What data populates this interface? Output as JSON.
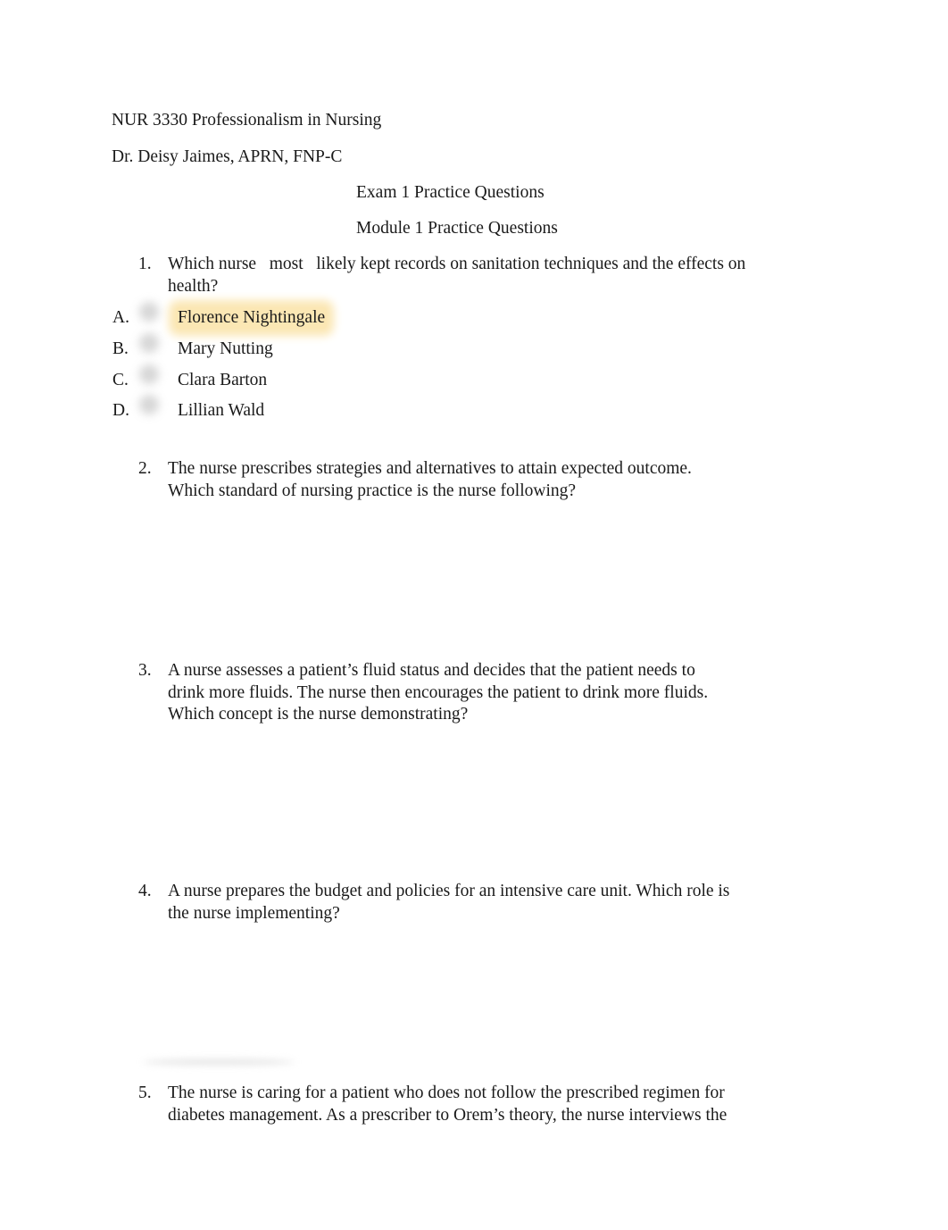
{
  "header": {
    "course": "NUR 3330 Professionalism in Nursing",
    "instructor": "Dr. Deisy Jaimes, APRN, FNP-C",
    "title": "Exam 1 Practice Questions",
    "subtitle": "Module 1 Practice Questions"
  },
  "questions": [
    {
      "number": "1.",
      "lines": [
        "Which nurse   most   likely kept records on sanitation techniques and the effects on",
        "health?"
      ],
      "options": [
        {
          "letter": "A.",
          "label": "Florence Nightingale",
          "highlighted": true
        },
        {
          "letter": "B.",
          "label": "Mary Nutting",
          "highlighted": false
        },
        {
          "letter": "C.",
          "label": "Clara Barton",
          "highlighted": false
        },
        {
          "letter": "D.",
          "label": "Lillian Wald",
          "highlighted": false
        }
      ]
    },
    {
      "number": "2.",
      "lines": [
        "The nurse prescribes strategies and alternatives to attain expected outcome.",
        "Which standard of nursing practice is the nurse following?"
      ]
    },
    {
      "number": "3.",
      "lines": [
        "A nurse assesses a patient’s fluid status and decides that the patient needs to",
        "drink more fluids. The nurse then encourages the patient to drink more fluids.",
        "Which concept is the nurse demonstrating?"
      ]
    },
    {
      "number": "4.",
      "lines": [
        "A nurse prepares the budget and policies for an intensive care unit. Which role is",
        "the nurse implementing?"
      ]
    },
    {
      "number": "5.",
      "lines": [
        "The nurse is caring for a patient who does not follow the prescribed regimen for",
        "diabetes management. As a prescriber to Orem’s theory, the nurse interviews the"
      ]
    }
  ],
  "colors": {
    "text": "#1a1a1a",
    "answer_highlight": "#fbe7b4"
  }
}
